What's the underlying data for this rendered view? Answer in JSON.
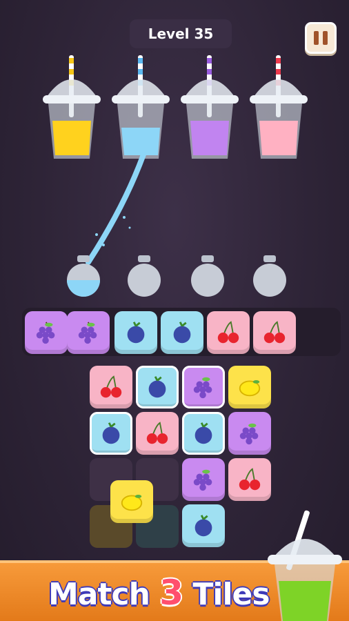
{
  "header": {
    "level_label": "Level 35"
  },
  "pause": {
    "icon": "pause-icon"
  },
  "cups": [
    {
      "name": "yellow-cup",
      "liquid": "#ffd21e",
      "straw": "#f5c518"
    },
    {
      "name": "blue-cup",
      "liquid": "#8dd6f7",
      "straw": "#5bb8f0"
    },
    {
      "name": "purple-cup",
      "liquid": "#c184f0",
      "straw": "#9b5ee0"
    },
    {
      "name": "pink-cup",
      "liquid": "#ffb1c2",
      "straw": "#ee3a4d"
    }
  ],
  "tray_tiles": [
    "grape",
    "grape",
    "blueberry",
    "blueberry",
    "cherry",
    "cherry"
  ],
  "board_tiles": [
    "cherry",
    "blueberry",
    "grape",
    "lemon",
    "blueberry",
    "cherry",
    "blueberry",
    "grape",
    "grape",
    "cherry",
    "lemon",
    "blueberry"
  ],
  "banner": {
    "word1": "Match",
    "number": "3",
    "word2": "Tiles"
  },
  "colors": {
    "accent": "#f59535",
    "text_outline": "#3e3ab8",
    "number": "#ff4f6d"
  }
}
